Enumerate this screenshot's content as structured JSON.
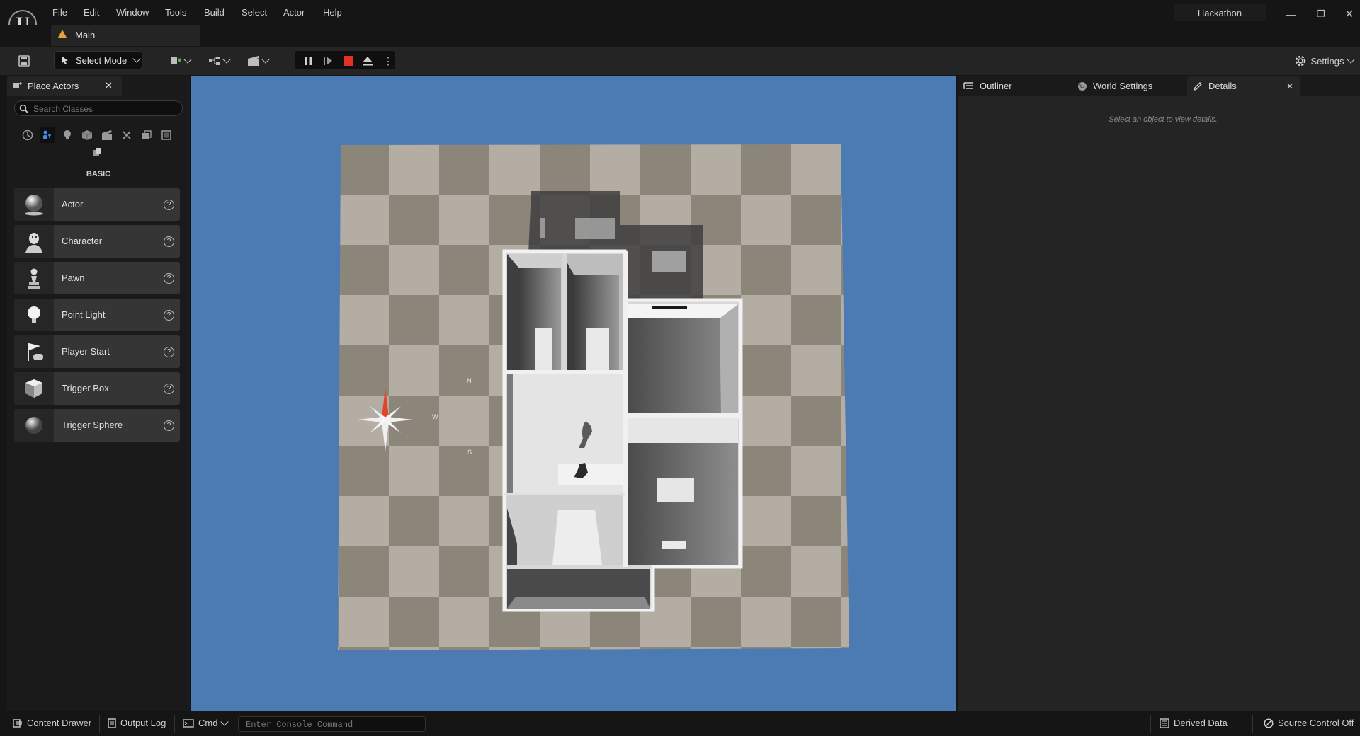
{
  "menu": [
    "File",
    "Edit",
    "Window",
    "Tools",
    "Build",
    "Select",
    "Actor",
    "Help"
  ],
  "project_name": "Hackathon",
  "tab": {
    "label": "Main"
  },
  "toolbar": {
    "select_mode_label": "Select Mode",
    "settings_label": "Settings"
  },
  "place_actors": {
    "tab_label": "Place Actors",
    "search_placeholder": "Search Classes",
    "category_icons": [
      "recent-icon",
      "basic-icon",
      "lights-icon",
      "shapes-icon",
      "cinematic-icon",
      "visual-effects-icon",
      "volumes-icon",
      "all-classes-icon",
      "geometry-icon"
    ],
    "section_label": "BASIC",
    "items": [
      {
        "label": "Actor",
        "icon": "sphere-icon"
      },
      {
        "label": "Character",
        "icon": "character-icon"
      },
      {
        "label": "Pawn",
        "icon": "pawn-icon"
      },
      {
        "label": "Point Light",
        "icon": "point-light-icon"
      },
      {
        "label": "Player Start",
        "icon": "player-start-icon"
      },
      {
        "label": "Trigger Box",
        "icon": "trigger-box-icon"
      },
      {
        "label": "Trigger Sphere",
        "icon": "trigger-sphere-icon"
      }
    ]
  },
  "viewport": {
    "compass": {
      "n": "N",
      "s": "S",
      "w": "W"
    },
    "colors": {
      "sky": "#4b7bb2",
      "floor_light": "#b4ada3",
      "floor_dark": "#8c857a",
      "compass_red": "#e0452a"
    }
  },
  "right_panel": {
    "tabs": [
      {
        "label": "Outliner",
        "icon": "outliner-icon"
      },
      {
        "label": "World Settings",
        "icon": "globe-icon"
      },
      {
        "label": "Details",
        "icon": "pencil-icon"
      }
    ],
    "details_message": "Select an object to view details."
  },
  "statusbar": {
    "content_drawer": "Content Drawer",
    "output_log": "Output Log",
    "cmd": "Cmd",
    "console_placeholder": "Enter Console Command",
    "derived_data": "Derived Data",
    "source_control": "Source Control Off"
  }
}
